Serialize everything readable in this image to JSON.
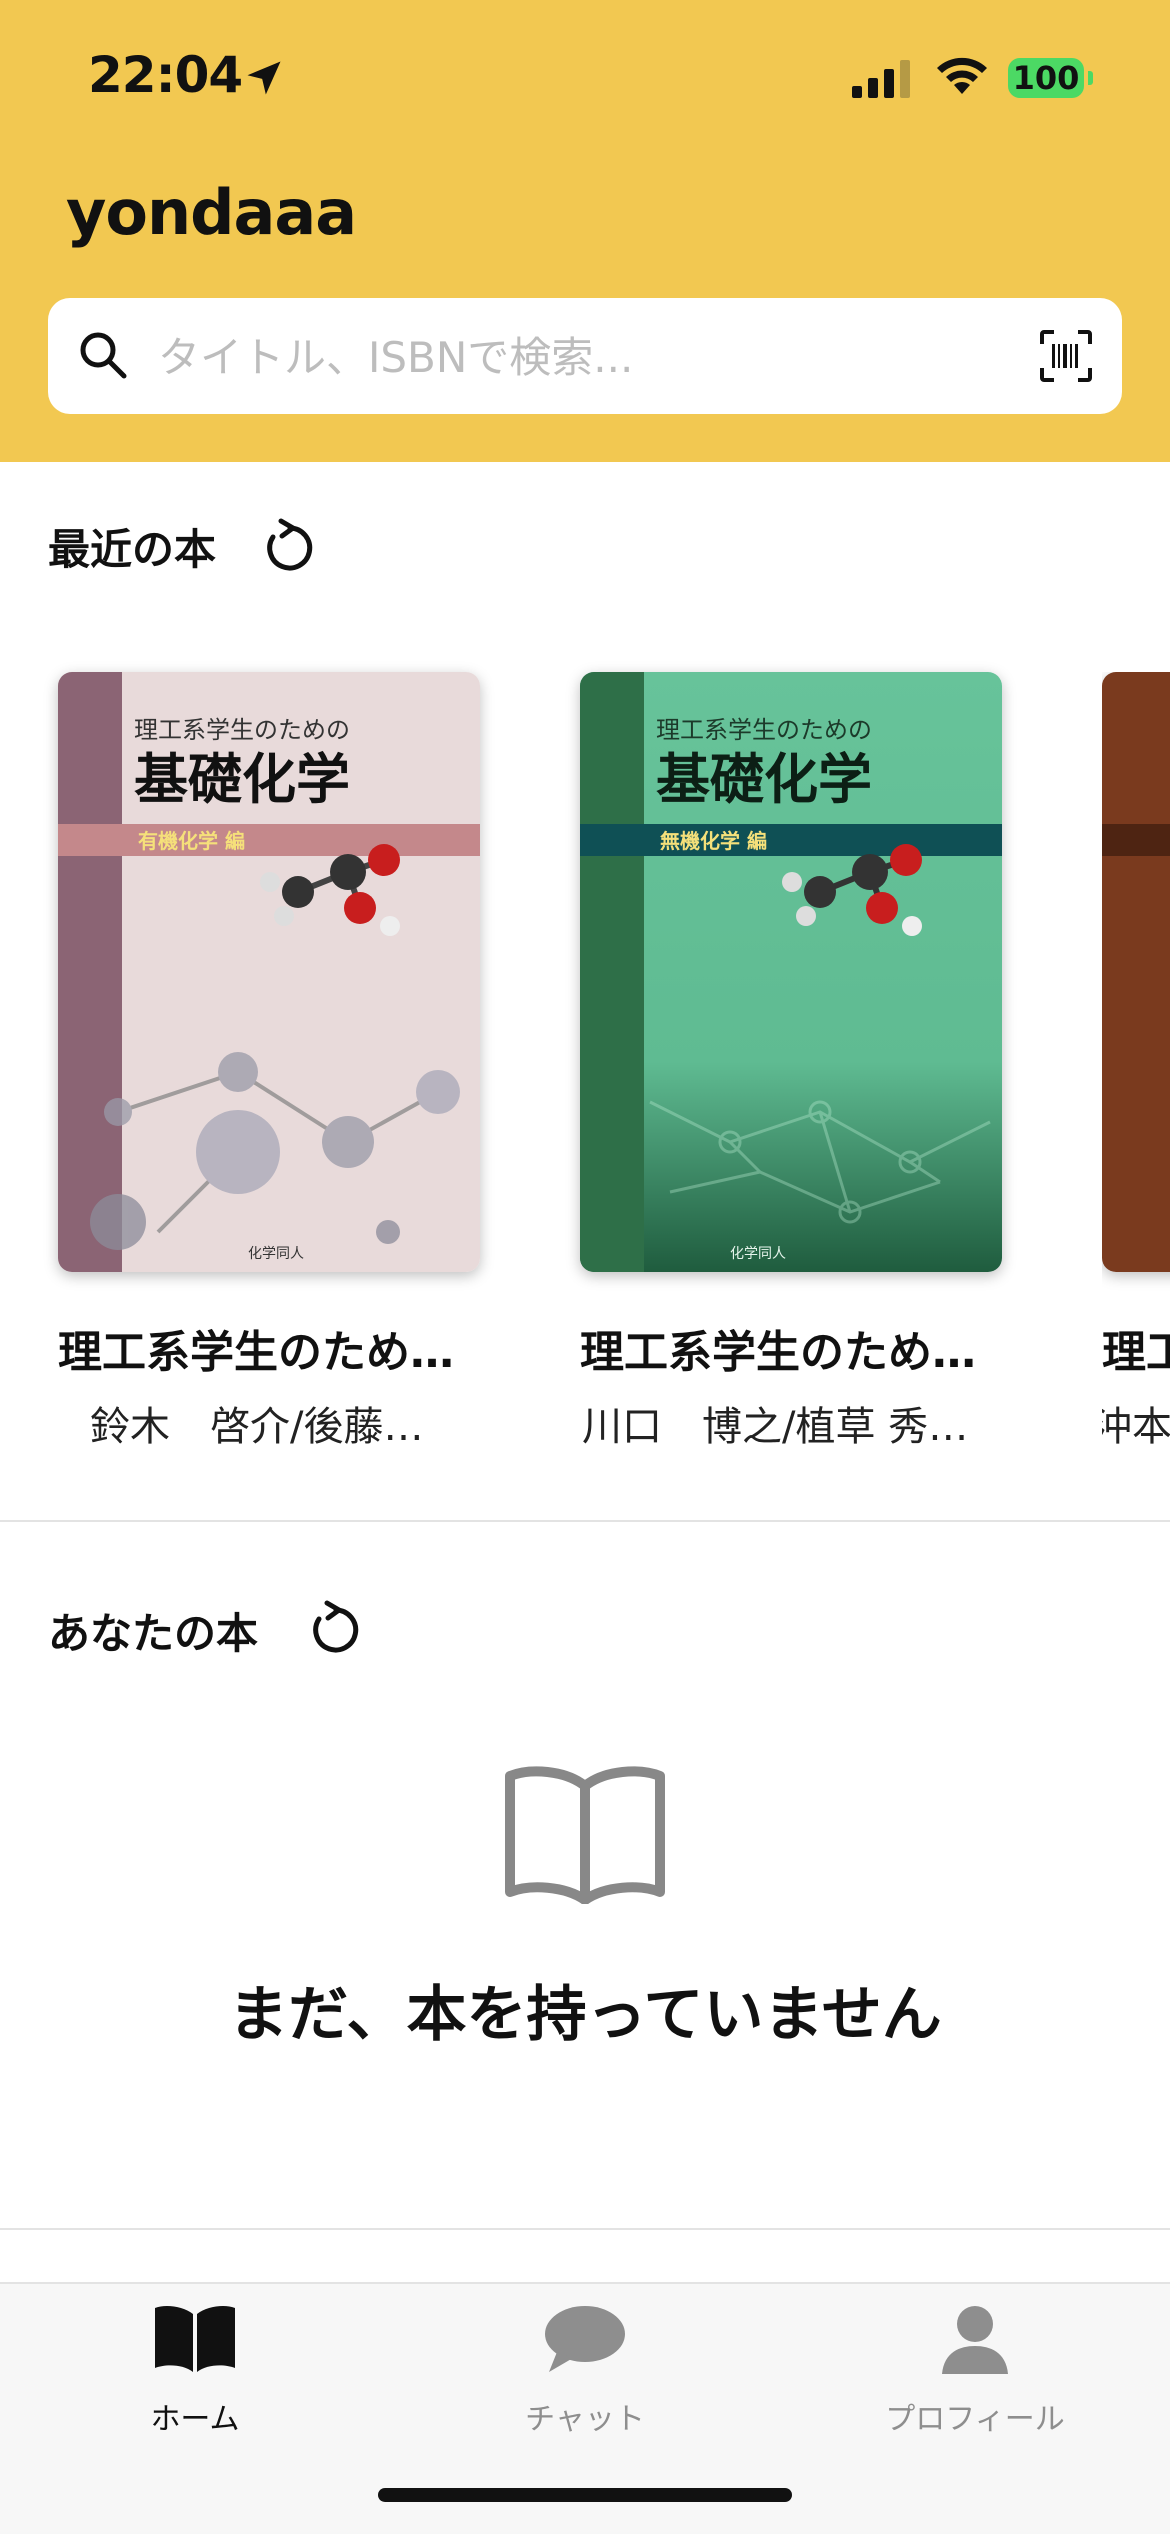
{
  "status_bar": {
    "time": "22:04",
    "battery": "100"
  },
  "app": {
    "title": "yondaaa"
  },
  "search": {
    "placeholder": "タイトル、ISBNで検索..."
  },
  "recent": {
    "title": "最近の本",
    "books": [
      {
        "title": "理工系学生のため…",
        "author": "鈴木　啓介/後藤…",
        "cover": {
          "small": "理工系学生のための",
          "big": "基礎化学",
          "band": "有機化学 編",
          "publisher": "化学同人",
          "bg": "#E8DADA",
          "spine": "#8B6474",
          "band_color": "#C4888B",
          "band_text": "#F5E07A"
        }
      },
      {
        "title": "理工系学生のため…",
        "author": "川口　博之/植草 秀…",
        "cover": {
          "small": "理工系学生のための",
          "big": "基礎化学",
          "band": "無機化学 編",
          "publisher": "化学同人",
          "bg": "#67C39A",
          "spine": "#2E6F48",
          "band_color": "#0F5055",
          "band_text": "#F5E07A"
        }
      },
      {
        "title": "理工",
        "author": "沖本",
        "cover": {
          "bg": "#7A3A1E"
        }
      }
    ]
  },
  "yours": {
    "title": "あなたの本",
    "empty_text": "まだ、本を持っていません"
  },
  "tabs": [
    {
      "label": "ホーム",
      "active": true
    },
    {
      "label": "チャット",
      "active": false
    },
    {
      "label": "プロフィール",
      "active": false
    }
  ],
  "colors": {
    "header": "#F2C851",
    "tab_active": "#111111",
    "tab_inactive": "#8E8E8E"
  }
}
